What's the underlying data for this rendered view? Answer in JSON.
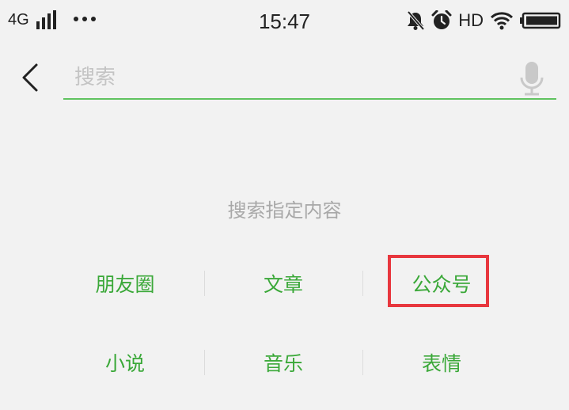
{
  "status_bar": {
    "network": "4G",
    "time": "15:47",
    "hd": "HD",
    "icons": [
      "signal-icon",
      "more-dots-icon",
      "mute-bell-icon",
      "alarm-icon",
      "wifi-icon",
      "battery-icon"
    ]
  },
  "search": {
    "placeholder": "搜索",
    "value": ""
  },
  "hint": "搜索指定内容",
  "categories": [
    [
      "朋友圈",
      "文章",
      "公众号"
    ],
    [
      "小说",
      "音乐",
      "表情"
    ]
  ],
  "colors": {
    "accent_green": "#3aa838",
    "underline_green": "#5fc35f",
    "highlight_red": "#e8373e",
    "background": "#f2f2f2"
  }
}
